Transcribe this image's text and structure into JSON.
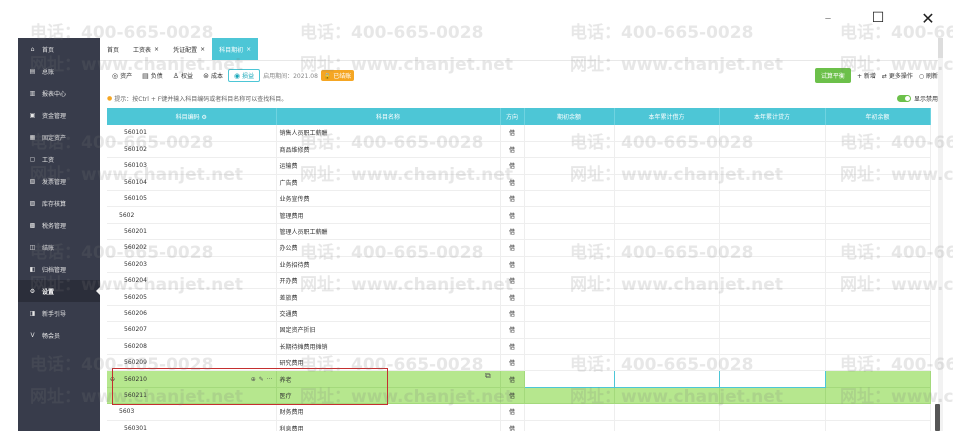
{
  "window_controls": {
    "minimize": "—",
    "maximize": "☐",
    "close": "✕"
  },
  "sidebar": {
    "items": [
      {
        "label": "首页",
        "icon": "home-icon",
        "glyph": "⌂"
      },
      {
        "label": "总账",
        "icon": "ledger-icon",
        "glyph": "▤"
      },
      {
        "label": "报表中心",
        "icon": "report-icon",
        "glyph": "▥"
      },
      {
        "label": "资金管理",
        "icon": "wallet-icon",
        "glyph": "▣"
      },
      {
        "label": "固定资产",
        "icon": "asset-icon",
        "glyph": "▦"
      },
      {
        "label": "工资",
        "icon": "salary-icon",
        "glyph": "▢"
      },
      {
        "label": "发票管理",
        "icon": "invoice-icon",
        "glyph": "▧"
      },
      {
        "label": "库存核算",
        "icon": "inventory-icon",
        "glyph": "▨"
      },
      {
        "label": "税务管理",
        "icon": "tax-icon",
        "glyph": "▩"
      },
      {
        "label": "结账",
        "icon": "close-period-icon",
        "glyph": "◫"
      },
      {
        "label": "归档管理",
        "icon": "archive-icon",
        "glyph": "◧"
      },
      {
        "label": "设置",
        "icon": "gear-icon",
        "glyph": "⚙"
      },
      {
        "label": "新手引导",
        "icon": "guide-icon",
        "glyph": "◨"
      },
      {
        "label": "畅会员",
        "icon": "vip-icon",
        "glyph": "V"
      }
    ],
    "active_index": 11
  },
  "tabs": [
    {
      "label": "首页",
      "closable": false
    },
    {
      "label": "工资表",
      "closable": true
    },
    {
      "label": "凭证配置",
      "closable": true
    },
    {
      "label": "科目期初",
      "closable": true,
      "active": true
    }
  ],
  "toolbar": {
    "categories": [
      {
        "label": "资产",
        "glyph": "◎"
      },
      {
        "label": "负债",
        "glyph": "▤"
      },
      {
        "label": "权益",
        "glyph": "♙"
      },
      {
        "label": "成本",
        "glyph": "⊜"
      },
      {
        "label": "损益",
        "glyph": "◉",
        "active": true
      }
    ],
    "enable_date": "启用期间：2021.08",
    "status_badge": "已结账",
    "trial_balance": "试算平衡",
    "add": "+ 新增",
    "more": "更多操作",
    "refresh": "刷新"
  },
  "tip": {
    "text": "提示：按Ctrl + F键并输入科目编码或者科目名称可以查找科目。",
    "toggle_label": "显示禁用"
  },
  "table": {
    "headers": [
      "科目编码",
      "科目名称",
      "方向",
      "期初余额",
      "本年累计借方",
      "本年累计贷方",
      "年初余额"
    ],
    "rows": [
      {
        "code": "560101",
        "name": "销售人员职工薪酬",
        "dir": "借",
        "lvl": 2
      },
      {
        "code": "560102",
        "name": "商品维修费",
        "dir": "借",
        "lvl": 2
      },
      {
        "code": "560103",
        "name": "运输费",
        "dir": "借",
        "lvl": 2
      },
      {
        "code": "560104",
        "name": "广告费",
        "dir": "借",
        "lvl": 2
      },
      {
        "code": "560105",
        "name": "业务宣传费",
        "dir": "借",
        "lvl": 2
      },
      {
        "code": "5602",
        "name": "管理费用",
        "dir": "借",
        "lvl": 1
      },
      {
        "code": "560201",
        "name": "管理人员职工薪酬",
        "dir": "借",
        "lvl": 2
      },
      {
        "code": "560202",
        "name": "办公费",
        "dir": "借",
        "lvl": 2
      },
      {
        "code": "560203",
        "name": "业务招待费",
        "dir": "借",
        "lvl": 2
      },
      {
        "code": "560204",
        "name": "开办费",
        "dir": "借",
        "lvl": 2
      },
      {
        "code": "560205",
        "name": "差旅费",
        "dir": "借",
        "lvl": 2
      },
      {
        "code": "560206",
        "name": "交通费",
        "dir": "借",
        "lvl": 2
      },
      {
        "code": "560207",
        "name": "固定资产折旧",
        "dir": "借",
        "lvl": 2
      },
      {
        "code": "560208",
        "name": "长期待摊费用摊销",
        "dir": "借",
        "lvl": 2
      },
      {
        "code": "560209",
        "name": "研究费用",
        "dir": "借",
        "lvl": 2
      },
      {
        "code": "560210",
        "name": "养老",
        "dir": "借",
        "lvl": 2,
        "highlight": true,
        "editing": true
      },
      {
        "code": "560211",
        "name": "医疗",
        "dir": "借",
        "lvl": 2,
        "highlight": true
      },
      {
        "code": "5603",
        "name": "财务费用",
        "dir": "借",
        "lvl": 1
      },
      {
        "code": "560301",
        "name": "利息费用",
        "dir": "借",
        "lvl": 2
      }
    ]
  },
  "watermark": {
    "phone": "电话：400-665-0028",
    "site": "网址：www.chanjet.net"
  }
}
